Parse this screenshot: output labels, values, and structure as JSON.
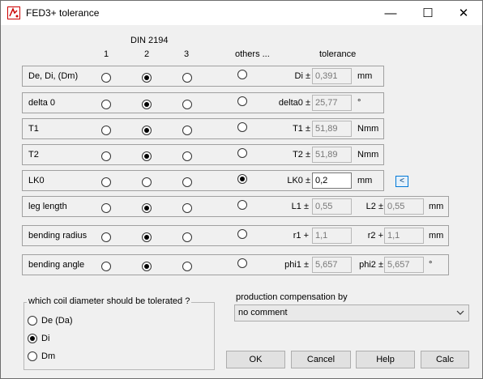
{
  "window": {
    "title": "FED3+ tolerance",
    "minimize": "—",
    "maximize": "☐",
    "close": "✕"
  },
  "header": {
    "din": "DIN 2194",
    "col1": "1",
    "col2": "2",
    "col3": "3",
    "others": "others ...",
    "tolerance": "tolerance"
  },
  "rows": [
    {
      "label": "De, Di, (Dm)",
      "plabel": "Di ±",
      "value": "0,391",
      "unit": "mm",
      "selected": 2
    },
    {
      "label": "delta 0",
      "plabel": "delta0 ±",
      "value": "25,77",
      "unit": "°",
      "selected": 2
    },
    {
      "label": "T1",
      "plabel": "T1 ±",
      "value": "51,89",
      "unit": "Nmm",
      "selected": 2
    },
    {
      "label": "T2",
      "plabel": "T2 ±",
      "value": "51,89",
      "unit": "Nmm",
      "selected": 2
    },
    {
      "label": "LK0",
      "plabel": "LK0 ±",
      "value": "0,2",
      "unit": "mm",
      "selected": 4,
      "arrow": "<"
    },
    {
      "label": "leg length",
      "plabel": "L1 ±",
      "value": "0,55",
      "plabel2": "L2 ±",
      "value2": "0,55",
      "unit": "mm",
      "selected": 2
    },
    {
      "label": "bending radius",
      "plabel": "r1 +",
      "value": "1,1",
      "plabel2": "r2 +",
      "value2": "1,1",
      "unit": "mm",
      "selected": 2
    },
    {
      "label": "bending angle",
      "plabel": "phi1 ±",
      "value": "5,657",
      "plabel2": "phi2 ±",
      "value2": "5,657",
      "unit": "°",
      "selected": 2
    }
  ],
  "coil": {
    "title": "which coil diameter should be tolerated ?",
    "options": [
      "De (Da)",
      "Di",
      "Dm"
    ],
    "selected": 1
  },
  "production": {
    "label": "production compensation by",
    "value": "no comment"
  },
  "buttons": {
    "ok": "OK",
    "cancel": "Cancel",
    "help": "Help",
    "calc": "Calc"
  }
}
